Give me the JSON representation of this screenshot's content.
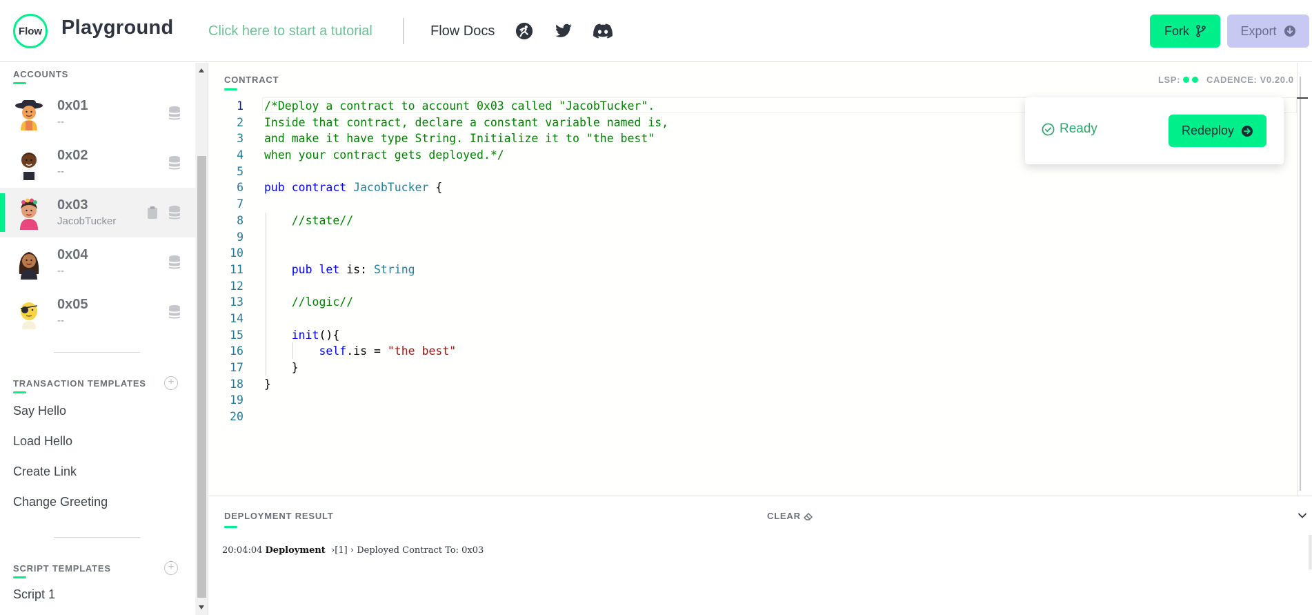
{
  "header": {
    "logo_text": "Flow",
    "title": "Playground",
    "tutorial_link": "Click here to start a tutorial",
    "docs_link": "Flow Docs",
    "social_icons": [
      "runner-icon",
      "twitter-icon",
      "discord-icon"
    ],
    "fork_label": "Fork",
    "export_label": "Export"
  },
  "sidebar": {
    "accounts_label": "ACCOUNTS",
    "accounts": [
      {
        "address": "0x01",
        "contract": "--",
        "selected": false
      },
      {
        "address": "0x02",
        "contract": "--",
        "selected": false
      },
      {
        "address": "0x03",
        "contract": "JacobTucker",
        "selected": true
      },
      {
        "address": "0x04",
        "contract": "--",
        "selected": false
      },
      {
        "address": "0x05",
        "contract": "--",
        "selected": false
      }
    ],
    "transaction_templates_label": "TRANSACTION TEMPLATES",
    "transaction_templates": [
      "Say Hello",
      "Load Hello",
      "Create Link",
      "Change Greeting"
    ],
    "script_templates_label": "SCRIPT TEMPLATES",
    "script_templates": [
      "Script 1"
    ]
  },
  "editor": {
    "label": "CONTRACT",
    "lsp_label": "LSP:",
    "cadence_version": "CADENCE: V0.20.0",
    "active_line": 1,
    "lines": [
      {
        "n": "1",
        "tokens": [
          {
            "c": "c",
            "t": "/*Deploy a contract to account 0x03 called \"JacobTucker\"."
          }
        ]
      },
      {
        "n": "2",
        "tokens": [
          {
            "c": "c",
            "t": "Inside that contract, declare a constant variable named is,"
          }
        ]
      },
      {
        "n": "3",
        "tokens": [
          {
            "c": "c",
            "t": "and make it have type String. Initialize it to \"the best\""
          }
        ]
      },
      {
        "n": "4",
        "tokens": [
          {
            "c": "c",
            "t": "when your contract gets deployed.*/"
          }
        ]
      },
      {
        "n": "5",
        "tokens": []
      },
      {
        "n": "6",
        "tokens": [
          {
            "c": "k",
            "t": "pub contract "
          },
          {
            "c": "t",
            "t": "JacobTucker"
          },
          {
            "c": "p",
            "t": " {"
          }
        ]
      },
      {
        "n": "7",
        "tokens": []
      },
      {
        "n": "8",
        "tokens": [
          {
            "c": "p",
            "t": "    "
          },
          {
            "c": "c",
            "t": "//state//"
          }
        ]
      },
      {
        "n": "9",
        "tokens": []
      },
      {
        "n": "10",
        "tokens": []
      },
      {
        "n": "11",
        "tokens": [
          {
            "c": "p",
            "t": "    "
          },
          {
            "c": "k",
            "t": "pub let"
          },
          {
            "c": "p",
            "t": " is: "
          },
          {
            "c": "t",
            "t": "String"
          }
        ]
      },
      {
        "n": "12",
        "tokens": []
      },
      {
        "n": "13",
        "tokens": [
          {
            "c": "p",
            "t": "    "
          },
          {
            "c": "c",
            "t": "//logic//"
          }
        ]
      },
      {
        "n": "14",
        "tokens": []
      },
      {
        "n": "15",
        "tokens": [
          {
            "c": "p",
            "t": "    "
          },
          {
            "c": "k",
            "t": "init"
          },
          {
            "c": "p",
            "t": "(){"
          }
        ]
      },
      {
        "n": "16",
        "tokens": [
          {
            "c": "p",
            "t": "        "
          },
          {
            "c": "k",
            "t": "self"
          },
          {
            "c": "p",
            "t": ".is = "
          },
          {
            "c": "s",
            "t": "\"the best\""
          }
        ]
      },
      {
        "n": "17",
        "tokens": [
          {
            "c": "p",
            "t": "    }"
          }
        ]
      },
      {
        "n": "18",
        "tokens": [
          {
            "c": "p",
            "t": "}"
          }
        ]
      },
      {
        "n": "19",
        "tokens": []
      },
      {
        "n": "20",
        "tokens": []
      }
    ]
  },
  "popup": {
    "status": "Ready",
    "redeploy_label": "Redeploy"
  },
  "results": {
    "label": "DEPLOYMENT RESULT",
    "clear_label": "CLEAR",
    "log": {
      "time": "20:04:04",
      "type": "Deployment",
      "index": "[1]",
      "message": "Deployed Contract To: 0x03"
    }
  },
  "colors": {
    "accent": "#00ef8b",
    "export_bg": "#c7c9f2",
    "status_ok": "#2ea36a"
  }
}
